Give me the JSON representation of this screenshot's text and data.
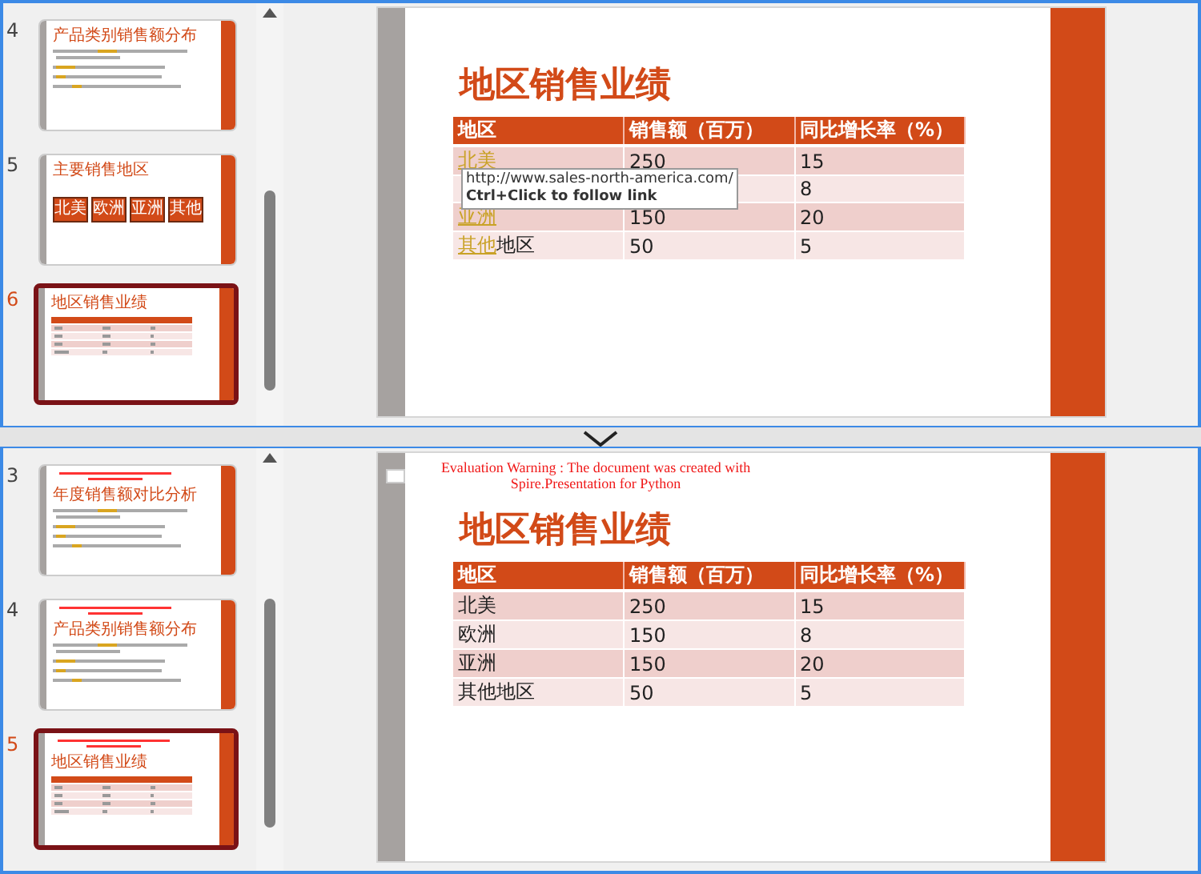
{
  "panes": [
    {
      "thumbnails": [
        {
          "number": "4",
          "selected": false,
          "kind": "bullets",
          "warning": false,
          "title": "产品类别销售额分布"
        },
        {
          "number": "5",
          "selected": false,
          "kind": "buttons",
          "warning": false,
          "title": "主要销售地区",
          "buttons": [
            "北美",
            "欧洲",
            "亚洲",
            "其他"
          ]
        },
        {
          "number": "6",
          "selected": true,
          "kind": "table",
          "warning": false,
          "title": "地区销售业绩"
        }
      ],
      "slide": {
        "title": "地区销售业绩",
        "columns": [
          "地区",
          "销售额（百万）",
          "同比增长率（%）"
        ],
        "rows": [
          {
            "region": [
              {
                "text": "北美",
                "link": true
              }
            ],
            "sales": "250",
            "growth": "15"
          },
          {
            "growth": "8"
          },
          {
            "region": [
              {
                "text": "亚洲",
                "link": true
              }
            ],
            "sales": "150",
            "growth": "20"
          },
          {
            "region": [
              {
                "text": "其他",
                "link": true
              },
              {
                "text": "地区",
                "link": false
              }
            ],
            "sales": "50",
            "growth": "5"
          }
        ],
        "tooltip": {
          "url": "http://www.sales-north-america.com/",
          "hint": "Ctrl+Click to follow link"
        }
      }
    },
    {
      "thumbnails": [
        {
          "number": "3",
          "selected": false,
          "kind": "bullets",
          "warning": true,
          "title": "年度销售额对比分析"
        },
        {
          "number": "4",
          "selected": false,
          "kind": "bullets",
          "warning": true,
          "title": "产品类别销售额分布"
        },
        {
          "number": "5",
          "selected": true,
          "kind": "table",
          "warning": true,
          "title": "地区销售业绩"
        }
      ],
      "slide": {
        "warning": [
          "Evaluation Warning : The document was created with",
          "Spire.Presentation for Python"
        ],
        "title": "地区销售业绩",
        "columns": [
          "地区",
          "销售额（百万）",
          "同比增长率（%）"
        ],
        "rows": [
          {
            "region": [
              {
                "text": "北美",
                "link": false
              }
            ],
            "sales": "250",
            "growth": "15"
          },
          {
            "region": [
              {
                "text": "欧洲",
                "link": false
              }
            ],
            "sales": "150",
            "growth": "8"
          },
          {
            "region": [
              {
                "text": "亚洲",
                "link": false
              }
            ],
            "sales": "150",
            "growth": "20"
          },
          {
            "region": [
              {
                "text": "其他地区",
                "link": false
              }
            ],
            "sales": "50",
            "growth": "5"
          }
        ]
      }
    }
  ]
}
